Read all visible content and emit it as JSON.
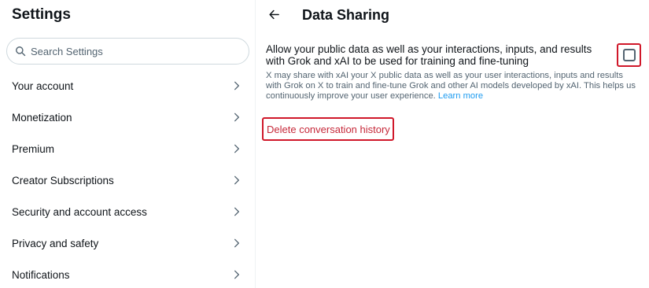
{
  "settings": {
    "title": "Settings",
    "search": {
      "placeholder": "Search Settings",
      "value": ""
    },
    "menu_items": [
      {
        "label": "Your account"
      },
      {
        "label": "Monetization"
      },
      {
        "label": "Premium"
      },
      {
        "label": "Creator Subscriptions"
      },
      {
        "label": "Security and account access"
      },
      {
        "label": "Privacy and safety"
      },
      {
        "label": "Notifications"
      }
    ]
  },
  "detail": {
    "title": "Data Sharing",
    "option": {
      "label": "Allow your public data as well as your interactions, inputs, and results with Grok and xAI to be used for training and fine-tuning",
      "checked": false,
      "description": "X may share with xAI your X public data as well as your user interactions, inputs and results with Grok on X to train and fine-tune Grok and other AI models developed by xAI. This helps us continuously improve your user experience.",
      "learn_more": "Learn more"
    },
    "delete_history": "Delete conversation history"
  },
  "icons": {
    "search": "search-icon",
    "chevron": "chevron-right-icon",
    "back": "arrow-left-icon"
  },
  "colors": {
    "text": "#0f1419",
    "secondary_text": "#536471",
    "link": "#1d9bf0",
    "danger": "#c62839",
    "highlight": "#d0182a"
  }
}
